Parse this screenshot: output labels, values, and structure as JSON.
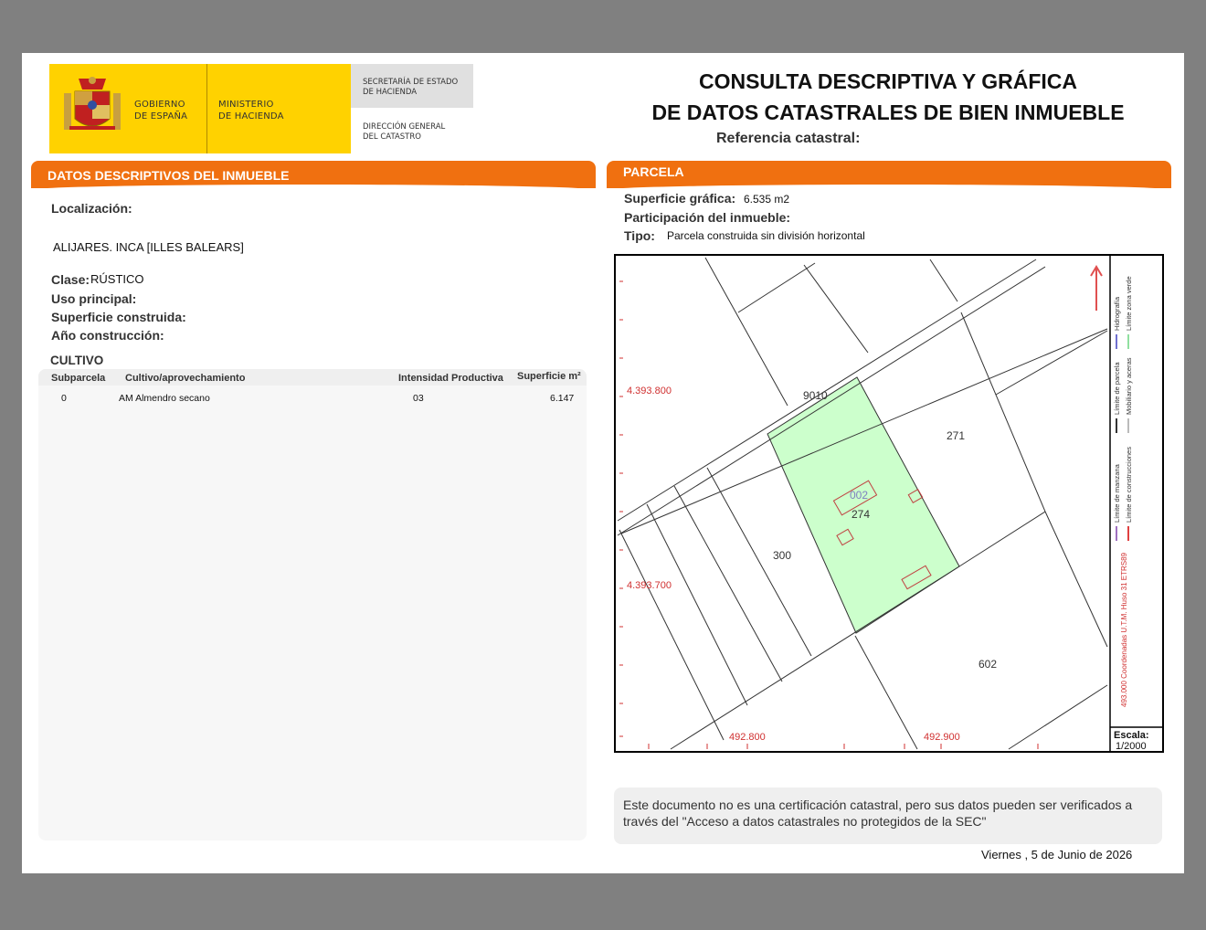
{
  "header": {
    "gov_line1": "GOBIERNO",
    "gov_line2": "DE ESPAÑA",
    "ministry_line1": "MINISTERIO",
    "ministry_line2": "DE HACIENDA",
    "sec_line1": "SECRETARÍA DE ESTADO",
    "sec_line2": "DE HACIENDA",
    "dg_line1": "DIRECCIÓN GENERAL",
    "dg_line2": "DEL CATASTRO",
    "title_line1": "CONSULTA DESCRIPTIVA Y GRÁFICA",
    "title_line2": "DE DATOS CATASTRALES DE BIEN INMUEBLE",
    "ref_label": "Referencia catastral:"
  },
  "left": {
    "section_title": "DATOS DESCRIPTIVOS DEL INMUEBLE",
    "localizacion_label": "Localización:",
    "localizacion_value": "ALIJARES. INCA [ILLES BALEARS]",
    "clase_label": "Clase:",
    "clase_value": "RÚSTICO",
    "uso_label": "Uso principal:",
    "superficie_label": "Superficie construida:",
    "anio_label": "Año construcción:",
    "cultivo_title": "CULTIVO",
    "table": {
      "headers": [
        "Subparcela",
        "Cultivo/aprovechamiento",
        "Intensidad Productiva",
        "Superficie m²"
      ],
      "rows": [
        [
          "0",
          "AM Almendro secano",
          "03",
          "6.147"
        ]
      ]
    }
  },
  "right": {
    "section_title": "PARCELA",
    "sup_label": "Superficie gráfica:",
    "sup_value": "6.535 m2",
    "part_label": "Participación del inmueble:",
    "tipo_label": "Tipo:",
    "tipo_value": "Parcela construida sin división horizontal"
  },
  "map": {
    "y_label_1": "4.393.800",
    "y_label_2": "4.393.700",
    "x_label_1": "492.800",
    "x_label_2": "492.900",
    "parcel_labels": [
      "9010",
      "271",
      "274",
      "300",
      "602"
    ],
    "building_label": "002",
    "legend_1": "Límite de manzana",
    "legend_2": "Límite de construcciones",
    "legend_3": "Límite de parcela",
    "legend_4": "Mobiliario y aceras",
    "legend_5": "Hidrografía",
    "legend_6": "Límite zona verde",
    "coords_note": "493.000 Coordenadas U.T.M. Huso 31 ETRS89",
    "scale_label": "Escala:",
    "scale_value": "1/2000",
    "colors": {
      "parcel_fill": "#ccffcc",
      "accent": "#f07010",
      "coord_red": "#d03030"
    }
  },
  "footer": {
    "note": "Este documento no es una certificación catastral, pero sus datos pueden ser verificados a través del \"Acceso a datos catastrales no protegidos de la SEC\"",
    "date": "Viernes , 5 de Junio de 2026"
  }
}
